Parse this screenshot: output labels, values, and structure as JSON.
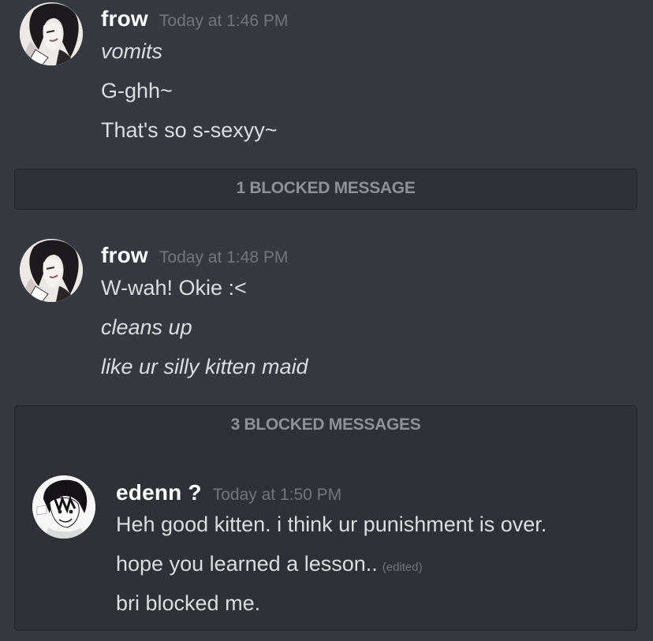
{
  "messages": [
    {
      "author": "frow",
      "timestamp": "Today at 1:46 PM",
      "avatar_icon": "user-avatar-frow",
      "lines": [
        "vomits",
        "G-ghh~",
        "That's so s-sexyy~"
      ]
    },
    {
      "author": "frow",
      "timestamp": "Today at 1:48 PM",
      "avatar_icon": "user-avatar-frow",
      "lines": [
        "W-wah! Okie :<",
        "cleans up",
        "like ur silly kitten maid"
      ]
    },
    {
      "author": "edenn ?",
      "timestamp": "Today at 1:50 PM",
      "avatar_icon": "user-avatar-edenn",
      "lines": [
        "Heh good kitten. i think ur punishment is over.",
        "hope you learned a lesson..",
        "bri blocked me."
      ],
      "edited_label": "(edited)"
    }
  ],
  "blocked": [
    {
      "label": "1 BLOCKED MESSAGE"
    },
    {
      "label": "3 BLOCKED MESSAGES"
    }
  ],
  "colors": {
    "background": "#36393f",
    "blocked_background": "#2f3136",
    "author": "#ffffff",
    "timestamp": "#72767d",
    "text": "#dcddde"
  }
}
